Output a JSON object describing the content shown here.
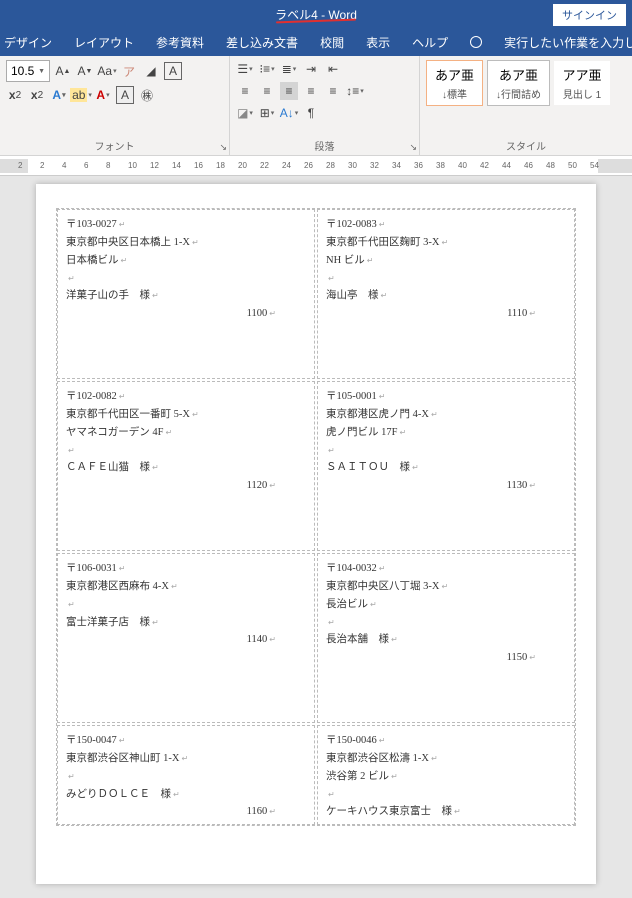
{
  "title": "ラベル4  -  Word",
  "signin": "サインイン",
  "menu": [
    "デザイン",
    "レイアウト",
    "参考資料",
    "差し込み文書",
    "校閲",
    "表示",
    "ヘルプ"
  ],
  "tell": "実行したい作業を入力してくだ",
  "font_group": "フォント",
  "para_group": "段落",
  "style_group": "スタイル",
  "font_size": "10.5",
  "style1": {
    "jp": "あア亜",
    "nm": "↓標準"
  },
  "style2": {
    "jp": "あア亜",
    "nm": "↓行間詰め"
  },
  "style3": {
    "jp": "アア亜",
    "nm": "見出し 1"
  },
  "ruler_vals": [
    "2",
    "2",
    "4",
    "6",
    "8",
    "10",
    "12",
    "14",
    "16",
    "18",
    "20",
    "22",
    "24",
    "26",
    "28",
    "30",
    "32",
    "34",
    "36",
    "38",
    "40",
    "42",
    "44",
    "46",
    "48",
    "50",
    "54"
  ],
  "labels": [
    {
      "postal": "〒103-0027",
      "addr": "東京都中央区日本橋上 1-X",
      "bldg": "日本橋ビル",
      "blank": "",
      "name": "洋菓子山の手　様",
      "code": "1100"
    },
    {
      "postal": "〒102-0083",
      "addr": "東京都千代田区麹町 3-X",
      "bldg": "NH ビル",
      "blank": "",
      "name": "海山亭　様",
      "code": "1110"
    },
    {
      "postal": "〒102-0082",
      "addr": "東京都千代田区一番町 5-X",
      "bldg": "ヤマネコガーデン 4F",
      "blank": "",
      "name": "ＣＡＦＥ山猫　様",
      "code": "1120"
    },
    {
      "postal": "〒105-0001",
      "addr": "東京都港区虎ノ門 4-X",
      "bldg": "虎ノ門ビル 17F",
      "blank": "",
      "name": "ＳＡＩＴＯＵ　様",
      "code": "1130"
    },
    {
      "postal": "〒106-0031",
      "addr": "東京都港区西麻布 4-X",
      "bldg": "",
      "blank": "",
      "name": "富士洋菓子店　様",
      "code": "1140"
    },
    {
      "postal": "〒104-0032",
      "addr": "東京都中央区八丁堀 3-X",
      "bldg": "長治ビル",
      "blank": "",
      "name": "長治本舗　様",
      "code": "1150"
    },
    {
      "postal": "〒150-0047",
      "addr": "東京都渋谷区神山町 1-X",
      "bldg": "",
      "blank": "",
      "name": "みどりＤＯＬＣＥ　様",
      "code": "1160"
    },
    {
      "postal": "〒150-0046",
      "addr": "東京都渋谷区松濤 1-X",
      "bldg": "渋谷第 2 ビル",
      "blank": "",
      "name": "ケーキハウス東京富士　様",
      "code": ""
    }
  ]
}
